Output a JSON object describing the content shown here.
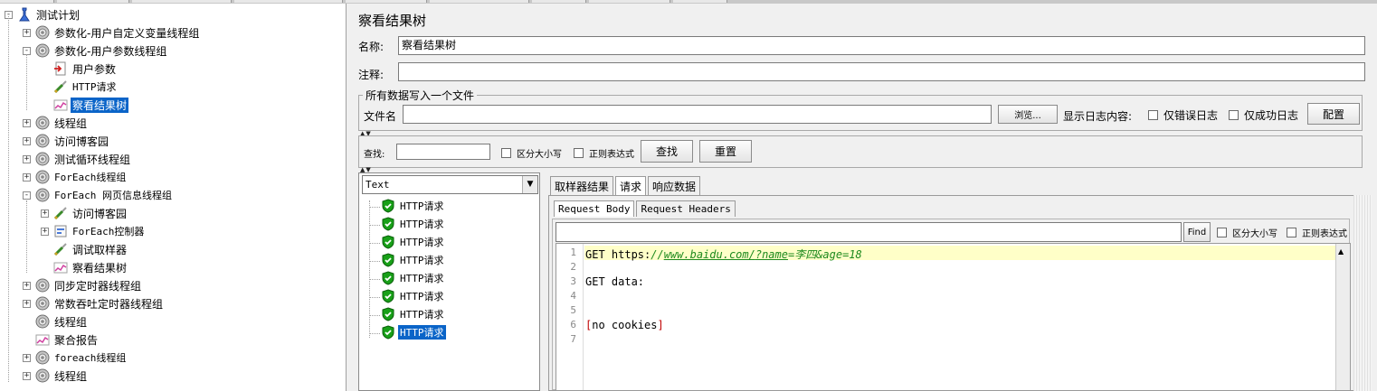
{
  "tree": {
    "items": [
      {
        "label": "测试计划",
        "icon": "test-plan-icon",
        "expander": "-"
      },
      {
        "label": "参数化-用户自定义变量线程组",
        "icon": "gear-icon",
        "expander": "+"
      },
      {
        "label": "参数化-用户参数线程组",
        "icon": "gear-icon",
        "expander": "-"
      },
      {
        "label": "用户参数",
        "icon": "preprocessor-icon",
        "expander": ""
      },
      {
        "label": "HTTP请求",
        "icon": "sampler-icon",
        "expander": ""
      },
      {
        "label": "察看结果树",
        "icon": "listener-icon",
        "expander": ""
      },
      {
        "label": "线程组",
        "icon": "gear-icon",
        "expander": "+"
      },
      {
        "label": "访问博客园",
        "icon": "gear-icon",
        "expander": "+"
      },
      {
        "label": "测试循环线程组",
        "icon": "gear-icon",
        "expander": "+"
      },
      {
        "label": "ForEach线程组",
        "icon": "gear-icon",
        "expander": "+"
      },
      {
        "label": "ForEach 网页信息线程组",
        "icon": "gear-icon",
        "expander": "-"
      },
      {
        "label": "访问博客园",
        "icon": "sampler-icon",
        "expander": "+"
      },
      {
        "label": "ForEach控制器",
        "icon": "controller-icon",
        "expander": "+"
      },
      {
        "label": "调试取样器",
        "icon": "sampler-icon",
        "expander": ""
      },
      {
        "label": "察看结果树",
        "icon": "listener-icon",
        "expander": ""
      },
      {
        "label": "同步定时器线程组",
        "icon": "gear-icon",
        "expander": "+"
      },
      {
        "label": "常数吞吐定时器线程组",
        "icon": "gear-icon",
        "expander": "+"
      },
      {
        "label": "线程组",
        "icon": "gear-icon",
        "expander": ""
      },
      {
        "label": "聚合报告",
        "icon": "listener-icon",
        "expander": ""
      },
      {
        "label": "foreach线程组",
        "icon": "gear-icon",
        "expander": "+"
      },
      {
        "label": "线程组",
        "icon": "gear-icon",
        "expander": "+"
      }
    ]
  },
  "panel": {
    "title": "察看结果树",
    "name_label": "名称:",
    "name_value": "察看结果树",
    "comment_label": "注释:",
    "comment_value": "",
    "file_group_title": "所有数据写入一个文件",
    "filename_label": "文件名",
    "filename_value": "",
    "browse_button": "浏览...",
    "log_content_label": "显示日志内容:",
    "errors_only": "仅错误日志",
    "success_only": "仅成功日志",
    "configure_button": "配置",
    "search_label": "查找:",
    "search_value": "",
    "case_sensitive": "区分大小写",
    "regex": "正则表达式",
    "find_button": "查找",
    "reset_button": "重置",
    "render_select": "Text",
    "results": [
      "HTTP请求",
      "HTTP请求",
      "HTTP请求",
      "HTTP请求",
      "HTTP请求",
      "HTTP请求",
      "HTTP请求",
      "HTTP请求"
    ],
    "tabs": [
      "取样器结果",
      "请求",
      "响应数据"
    ],
    "subtabs": [
      "Request Body",
      "Request Headers"
    ],
    "find_input_value": "",
    "find_small_button": "Find",
    "find_case": "区分大小写",
    "find_regex": "正则表达式",
    "lines": [
      {
        "no": "1",
        "parts": [
          {
            "t": "GET https:",
            "c": "#000"
          },
          {
            "t": "//",
            "c": "#1e8a1e"
          },
          {
            "t": "www.baidu.com/",
            "c": "#1e8a1e",
            "u": true
          },
          {
            "t": "?name",
            "c": "#1e8a1e",
            "u": true
          },
          {
            "t": "=李四&age=18",
            "c": "#1e8a1e"
          }
        ]
      },
      {
        "no": "2",
        "parts": []
      },
      {
        "no": "3",
        "parts": [
          {
            "t": "GET data:",
            "c": "#000"
          }
        ]
      },
      {
        "no": "4",
        "parts": []
      },
      {
        "no": "5",
        "parts": []
      },
      {
        "no": "6",
        "parts": [
          {
            "t": "[",
            "c": "#c00000"
          },
          {
            "t": "no cookies",
            "c": "#000"
          },
          {
            "t": "]",
            "c": "#c00000"
          }
        ]
      },
      {
        "no": "7",
        "parts": []
      }
    ]
  },
  "colors": {
    "selection": "#0a64c8",
    "highlight_line": "#ffffc8",
    "url_green": "#1e8a1e"
  }
}
